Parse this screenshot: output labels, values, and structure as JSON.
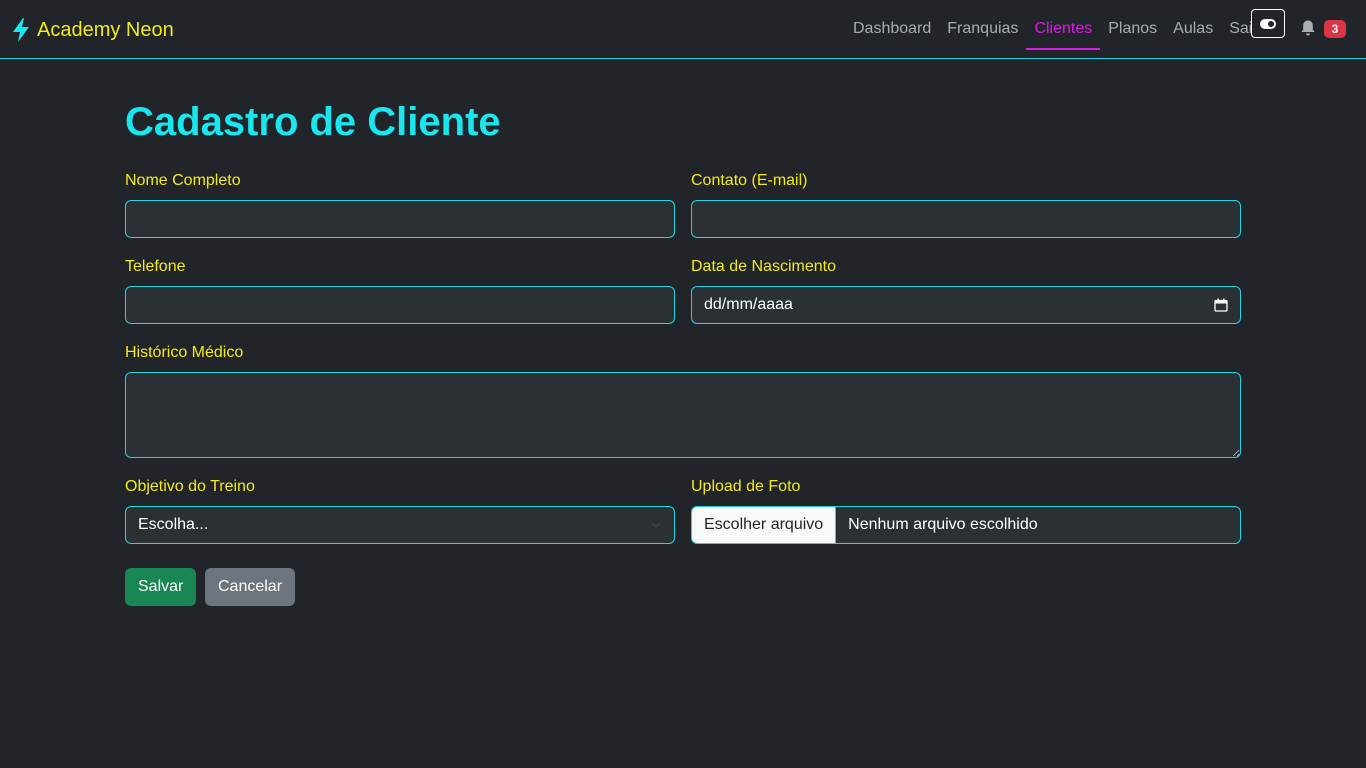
{
  "navbar": {
    "brand": "Academy Neon",
    "brand_icon": "lightning-bolt-icon",
    "links": [
      {
        "label": "Dashboard",
        "active": false
      },
      {
        "label": "Franquias",
        "active": false
      },
      {
        "label": "Clientes",
        "active": true
      },
      {
        "label": "Planos",
        "active": false
      },
      {
        "label": "Aulas",
        "active": false
      },
      {
        "label": "Sair",
        "active": false
      }
    ],
    "theme_toggle_icon": "toggle-icon",
    "notifications_icon": "bell-icon",
    "notification_count": "3"
  },
  "page": {
    "title": "Cadastro de Cliente"
  },
  "form": {
    "nome_label": "Nome Completo",
    "contato_label": "Contato (E-mail)",
    "telefone_label": "Telefone",
    "nascimento_label": "Data de Nascimento",
    "nascimento_value": "dd/mm/aaaa",
    "historico_label": "Histórico Médico",
    "objetivo_label": "Objetivo do Treino",
    "objetivo_value": "Escolha...",
    "foto_label": "Upload de Foto",
    "file_button": "Escolher arquivo",
    "file_status": "Nenhum arquivo escolhido",
    "save_label": "Salvar",
    "cancel_label": "Cancelar"
  },
  "colors": {
    "background": "#212529",
    "accent_cyan": "#19e6ee",
    "label_yellow": "#f2ea1d",
    "active_magenta": "#d91ce6",
    "save_green": "#198754",
    "cancel_gray": "#6c757d",
    "badge_red": "#dc3545"
  }
}
